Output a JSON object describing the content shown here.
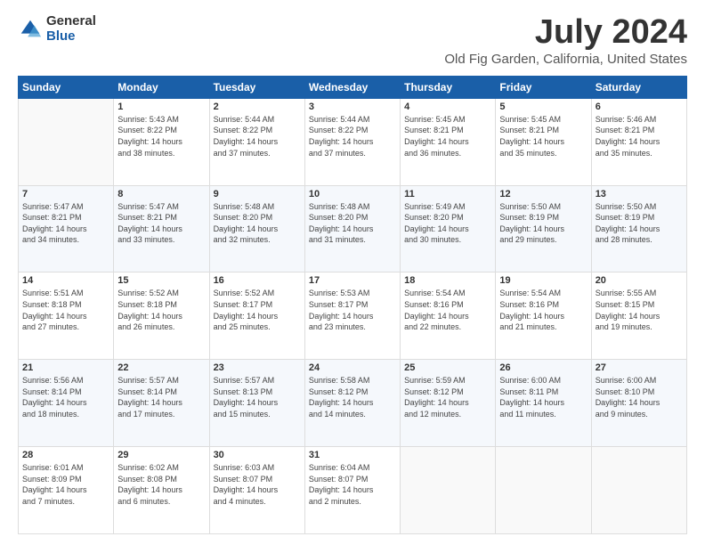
{
  "logo": {
    "general": "General",
    "blue": "Blue"
  },
  "header": {
    "title": "July 2024",
    "subtitle": "Old Fig Garden, California, United States"
  },
  "days_of_week": [
    "Sunday",
    "Monday",
    "Tuesday",
    "Wednesday",
    "Thursday",
    "Friday",
    "Saturday"
  ],
  "weeks": [
    [
      {
        "day": "",
        "info": ""
      },
      {
        "day": "1",
        "info": "Sunrise: 5:43 AM\nSunset: 8:22 PM\nDaylight: 14 hours\nand 38 minutes."
      },
      {
        "day": "2",
        "info": "Sunrise: 5:44 AM\nSunset: 8:22 PM\nDaylight: 14 hours\nand 37 minutes."
      },
      {
        "day": "3",
        "info": "Sunrise: 5:44 AM\nSunset: 8:22 PM\nDaylight: 14 hours\nand 37 minutes."
      },
      {
        "day": "4",
        "info": "Sunrise: 5:45 AM\nSunset: 8:21 PM\nDaylight: 14 hours\nand 36 minutes."
      },
      {
        "day": "5",
        "info": "Sunrise: 5:45 AM\nSunset: 8:21 PM\nDaylight: 14 hours\nand 35 minutes."
      },
      {
        "day": "6",
        "info": "Sunrise: 5:46 AM\nSunset: 8:21 PM\nDaylight: 14 hours\nand 35 minutes."
      }
    ],
    [
      {
        "day": "7",
        "info": "Sunrise: 5:47 AM\nSunset: 8:21 PM\nDaylight: 14 hours\nand 34 minutes."
      },
      {
        "day": "8",
        "info": "Sunrise: 5:47 AM\nSunset: 8:21 PM\nDaylight: 14 hours\nand 33 minutes."
      },
      {
        "day": "9",
        "info": "Sunrise: 5:48 AM\nSunset: 8:20 PM\nDaylight: 14 hours\nand 32 minutes."
      },
      {
        "day": "10",
        "info": "Sunrise: 5:48 AM\nSunset: 8:20 PM\nDaylight: 14 hours\nand 31 minutes."
      },
      {
        "day": "11",
        "info": "Sunrise: 5:49 AM\nSunset: 8:20 PM\nDaylight: 14 hours\nand 30 minutes."
      },
      {
        "day": "12",
        "info": "Sunrise: 5:50 AM\nSunset: 8:19 PM\nDaylight: 14 hours\nand 29 minutes."
      },
      {
        "day": "13",
        "info": "Sunrise: 5:50 AM\nSunset: 8:19 PM\nDaylight: 14 hours\nand 28 minutes."
      }
    ],
    [
      {
        "day": "14",
        "info": "Sunrise: 5:51 AM\nSunset: 8:18 PM\nDaylight: 14 hours\nand 27 minutes."
      },
      {
        "day": "15",
        "info": "Sunrise: 5:52 AM\nSunset: 8:18 PM\nDaylight: 14 hours\nand 26 minutes."
      },
      {
        "day": "16",
        "info": "Sunrise: 5:52 AM\nSunset: 8:17 PM\nDaylight: 14 hours\nand 25 minutes."
      },
      {
        "day": "17",
        "info": "Sunrise: 5:53 AM\nSunset: 8:17 PM\nDaylight: 14 hours\nand 23 minutes."
      },
      {
        "day": "18",
        "info": "Sunrise: 5:54 AM\nSunset: 8:16 PM\nDaylight: 14 hours\nand 22 minutes."
      },
      {
        "day": "19",
        "info": "Sunrise: 5:54 AM\nSunset: 8:16 PM\nDaylight: 14 hours\nand 21 minutes."
      },
      {
        "day": "20",
        "info": "Sunrise: 5:55 AM\nSunset: 8:15 PM\nDaylight: 14 hours\nand 19 minutes."
      }
    ],
    [
      {
        "day": "21",
        "info": "Sunrise: 5:56 AM\nSunset: 8:14 PM\nDaylight: 14 hours\nand 18 minutes."
      },
      {
        "day": "22",
        "info": "Sunrise: 5:57 AM\nSunset: 8:14 PM\nDaylight: 14 hours\nand 17 minutes."
      },
      {
        "day": "23",
        "info": "Sunrise: 5:57 AM\nSunset: 8:13 PM\nDaylight: 14 hours\nand 15 minutes."
      },
      {
        "day": "24",
        "info": "Sunrise: 5:58 AM\nSunset: 8:12 PM\nDaylight: 14 hours\nand 14 minutes."
      },
      {
        "day": "25",
        "info": "Sunrise: 5:59 AM\nSunset: 8:12 PM\nDaylight: 14 hours\nand 12 minutes."
      },
      {
        "day": "26",
        "info": "Sunrise: 6:00 AM\nSunset: 8:11 PM\nDaylight: 14 hours\nand 11 minutes."
      },
      {
        "day": "27",
        "info": "Sunrise: 6:00 AM\nSunset: 8:10 PM\nDaylight: 14 hours\nand 9 minutes."
      }
    ],
    [
      {
        "day": "28",
        "info": "Sunrise: 6:01 AM\nSunset: 8:09 PM\nDaylight: 14 hours\nand 7 minutes."
      },
      {
        "day": "29",
        "info": "Sunrise: 6:02 AM\nSunset: 8:08 PM\nDaylight: 14 hours\nand 6 minutes."
      },
      {
        "day": "30",
        "info": "Sunrise: 6:03 AM\nSunset: 8:07 PM\nDaylight: 14 hours\nand 4 minutes."
      },
      {
        "day": "31",
        "info": "Sunrise: 6:04 AM\nSunset: 8:07 PM\nDaylight: 14 hours\nand 2 minutes."
      },
      {
        "day": "",
        "info": ""
      },
      {
        "day": "",
        "info": ""
      },
      {
        "day": "",
        "info": ""
      }
    ]
  ]
}
